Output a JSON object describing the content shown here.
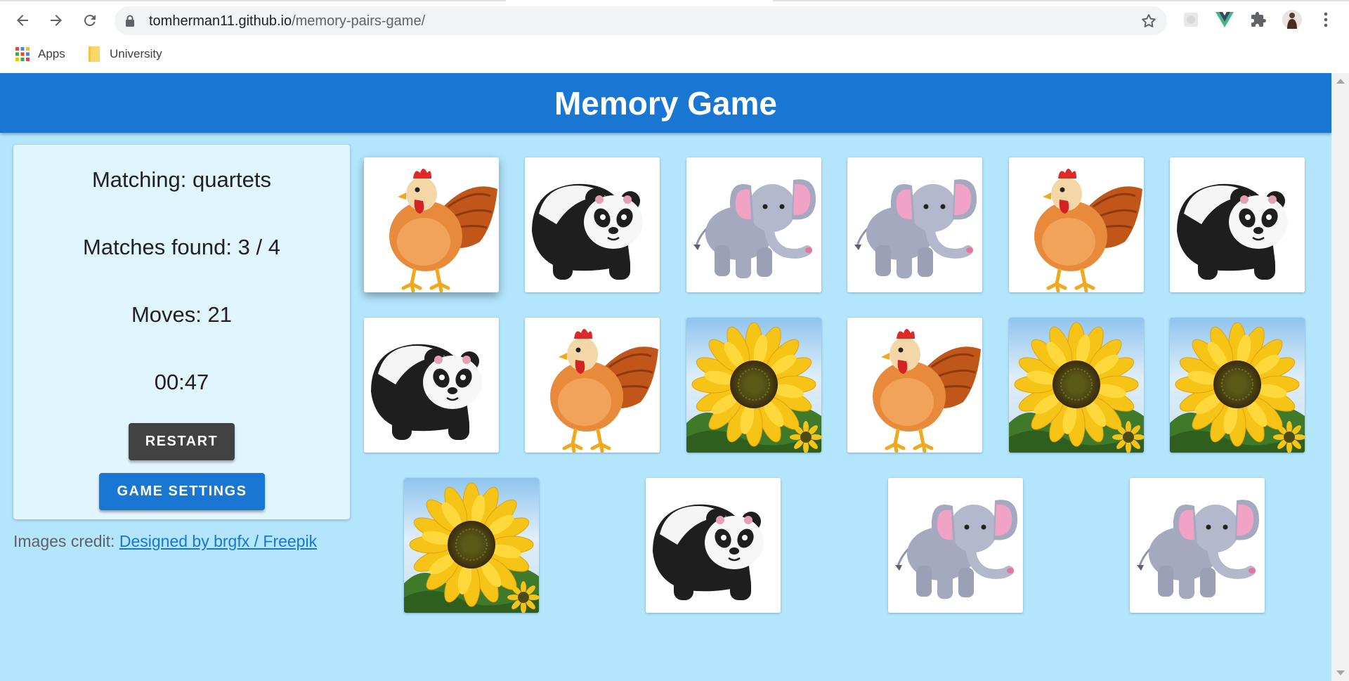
{
  "browser": {
    "url_host": "tomherman11.github.io",
    "url_path": "/memory-pairs-game/",
    "bookmarks": [
      {
        "label": "Apps",
        "icon": "apps-grid-icon"
      },
      {
        "label": "University",
        "icon": "folder-icon"
      }
    ]
  },
  "app": {
    "title": "Memory Game"
  },
  "stats": {
    "matching": "Matching: quartets",
    "matches_found": "Matches found: 3 / 4",
    "moves": "Moves: 21",
    "timer": "00:47"
  },
  "buttons": {
    "restart": "RESTART",
    "settings": "GAME SETTINGS"
  },
  "credit": {
    "prefix": "Images credit: ",
    "link_text": "Designed by brgfx / Freepik"
  },
  "cards": [
    {
      "image": "rooster",
      "state": "face-up"
    },
    {
      "image": "panda",
      "state": "face-up"
    },
    {
      "image": "elephant",
      "state": "face-up"
    },
    {
      "image": "elephant",
      "state": "face-up"
    },
    {
      "image": "rooster",
      "state": "face-up"
    },
    {
      "image": "panda",
      "state": "face-up"
    },
    {
      "image": "panda",
      "state": "face-up"
    },
    {
      "image": "rooster",
      "state": "face-up"
    },
    {
      "image": "sunflower",
      "state": "face-up"
    },
    {
      "image": "rooster",
      "state": "face-up"
    },
    {
      "image": "sunflower",
      "state": "face-up"
    },
    {
      "image": "sunflower",
      "state": "face-up"
    },
    {
      "image": "sunflower",
      "state": "face-up"
    },
    {
      "image": "panda",
      "state": "face-up"
    },
    {
      "image": "elephant",
      "state": "face-up"
    },
    {
      "image": "elephant",
      "state": "face-up"
    }
  ],
  "colors": {
    "appbar": "#1976d2",
    "background": "#b3e5fc",
    "panel": "#e1f5fe",
    "restart_button": "#424242",
    "settings_button": "#1976d2"
  }
}
